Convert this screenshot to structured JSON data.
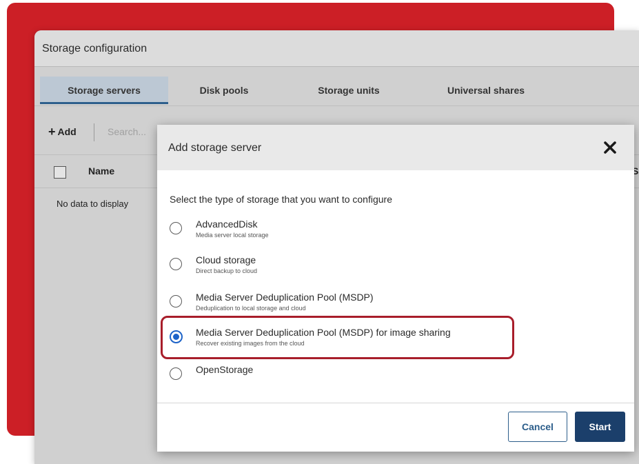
{
  "app": {
    "title": "Storage configuration",
    "tabs": [
      {
        "label": "Storage servers",
        "active": true
      },
      {
        "label": "Disk pools",
        "active": false
      },
      {
        "label": "Storage units",
        "active": false
      },
      {
        "label": "Universal shares",
        "active": false
      }
    ],
    "toolbar": {
      "add_label": "Add",
      "search_placeholder": "Search..."
    },
    "table": {
      "columns": [
        "Name",
        "S"
      ],
      "empty_message": "No data to display"
    }
  },
  "dialog": {
    "title": "Add storage server",
    "prompt": "Select the type of storage that you want to configure",
    "options": [
      {
        "label": "AdvancedDisk",
        "description": "Media server local storage",
        "selected": false
      },
      {
        "label": "Cloud storage",
        "description": "Direct backup to cloud",
        "selected": false
      },
      {
        "label": "Media Server Deduplication Pool (MSDP)",
        "description": "Deduplication to local storage and cloud",
        "selected": false
      },
      {
        "label": "Media Server Deduplication Pool (MSDP) for image sharing",
        "description": "Recover existing images from the cloud",
        "selected": true
      },
      {
        "label": "OpenStorage",
        "description": "",
        "selected": false
      }
    ],
    "cancel_label": "Cancel",
    "start_label": "Start"
  },
  "colors": {
    "brand_red": "#cc1f26",
    "highlight_border": "#a81d2a",
    "radio_selected": "#1d63c8",
    "primary_button": "#1b3f6b"
  },
  "icons": {
    "add": "plus-icon",
    "close": "close-x-icon",
    "checkbox": "checkbox-icon"
  }
}
